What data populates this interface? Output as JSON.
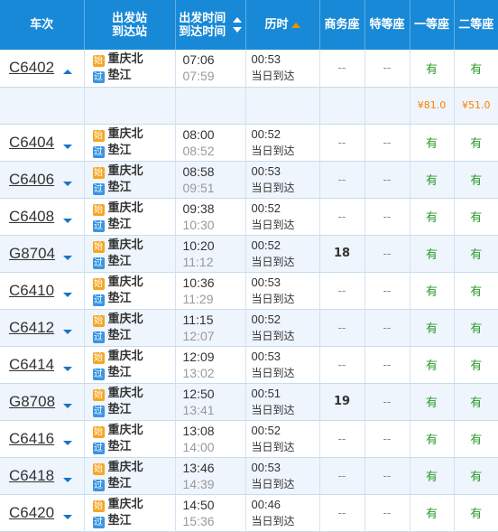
{
  "headers": {
    "train": "车次",
    "station_top": "出发站",
    "station_bottom": "到达站",
    "time_top": "出发时间",
    "time_bottom": "到达时间",
    "duration": "历时",
    "business": "商务座",
    "special": "特等座",
    "first": "一等座",
    "second": "二等座"
  },
  "badges": {
    "start": "始",
    "pass": "过"
  },
  "trains": [
    {
      "code": "C6402",
      "from": "重庆北",
      "to": "垫江",
      "dep": "07:06",
      "arr": "07:59",
      "dur": "00:53",
      "arrive_note": "当日到达",
      "business": "--",
      "special": "--",
      "first": "有",
      "second": "有",
      "expanded": true
    },
    {
      "code": "C6404",
      "from": "重庆北",
      "to": "垫江",
      "dep": "08:00",
      "arr": "08:52",
      "dur": "00:52",
      "arrive_note": "当日到达",
      "business": "--",
      "special": "--",
      "first": "有",
      "second": "有"
    },
    {
      "code": "C6406",
      "from": "重庆北",
      "to": "垫江",
      "dep": "08:58",
      "arr": "09:51",
      "dur": "00:53",
      "arrive_note": "当日到达",
      "business": "--",
      "special": "--",
      "first": "有",
      "second": "有"
    },
    {
      "code": "C6408",
      "from": "重庆北",
      "to": "垫江",
      "dep": "09:38",
      "arr": "10:30",
      "dur": "00:52",
      "arrive_note": "当日到达",
      "business": "--",
      "special": "--",
      "first": "有",
      "second": "有"
    },
    {
      "code": "G8704",
      "from": "重庆北",
      "to": "垫江",
      "dep": "10:20",
      "arr": "11:12",
      "dur": "00:52",
      "arrive_note": "当日到达",
      "business": "18",
      "special": "--",
      "first": "有",
      "second": "有"
    },
    {
      "code": "C6410",
      "from": "重庆北",
      "to": "垫江",
      "dep": "10:36",
      "arr": "11:29",
      "dur": "00:53",
      "arrive_note": "当日到达",
      "business": "--",
      "special": "--",
      "first": "有",
      "second": "有"
    },
    {
      "code": "C6412",
      "from": "重庆北",
      "to": "垫江",
      "dep": "11:15",
      "arr": "12:07",
      "dur": "00:52",
      "arrive_note": "当日到达",
      "business": "--",
      "special": "--",
      "first": "有",
      "second": "有"
    },
    {
      "code": "C6414",
      "from": "重庆北",
      "to": "垫江",
      "dep": "12:09",
      "arr": "13:02",
      "dur": "00:53",
      "arrive_note": "当日到达",
      "business": "--",
      "special": "--",
      "first": "有",
      "second": "有"
    },
    {
      "code": "G8708",
      "from": "重庆北",
      "to": "垫江",
      "dep": "12:50",
      "arr": "13:41",
      "dur": "00:51",
      "arrive_note": "当日到达",
      "business": "19",
      "special": "--",
      "first": "有",
      "second": "有"
    },
    {
      "code": "C6416",
      "from": "重庆北",
      "to": "垫江",
      "dep": "13:08",
      "arr": "14:00",
      "dur": "00:52",
      "arrive_note": "当日到达",
      "business": "--",
      "special": "--",
      "first": "有",
      "second": "有"
    },
    {
      "code": "C6418",
      "from": "重庆北",
      "to": "垫江",
      "dep": "13:46",
      "arr": "14:39",
      "dur": "00:53",
      "arrive_note": "当日到达",
      "business": "--",
      "special": "--",
      "first": "有",
      "second": "有"
    },
    {
      "code": "C6420",
      "from": "重庆北",
      "to": "垫江",
      "dep": "14:50",
      "arr": "15:36",
      "dur": "00:46",
      "arrive_note": "当日到达",
      "business": "--",
      "special": "--",
      "first": "有",
      "second": "有"
    }
  ],
  "price_row": {
    "first": "¥81.0",
    "second": "¥51.0"
  },
  "colors": {
    "header_bg": "#1889d6",
    "available": "#2a9a2a",
    "price": "#ff7e00",
    "start_badge": "#f5a623",
    "pass_badge": "#3a94e0"
  }
}
